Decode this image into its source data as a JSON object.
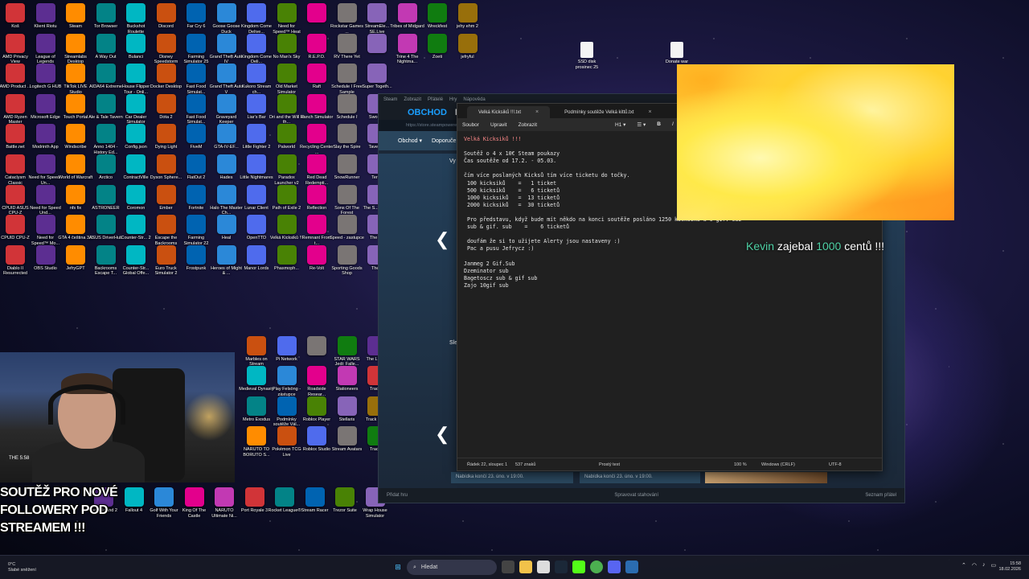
{
  "desktop": {
    "icons": [
      "Koš",
      "Klient Riotu",
      "Steam",
      "Tor Browser",
      "Buckshot Roulette",
      "Discord",
      "Far Cry 6",
      "Goose Goose Duck",
      "Kingdom Come Delive...",
      "Need for Speed™ Heat",
      "",
      "Rockstar Games ...",
      "StreamEle... SE.Live",
      "Tribes of Midgard",
      "Wreckfest",
      "jehy ehm 2",
      "AMD Privacy View",
      "League of Legends",
      "Streamlabs Desktop",
      "A Way Out",
      "Bulanci",
      "Disney Speedstorm",
      "Farming Simulator 25",
      "Grand Theft Auto IV",
      "Kingdom Come Deli...",
      "No Man's Sky",
      "R.E.P.O.",
      "RV There Yet",
      "",
      "Trine 4 The Nightma...",
      "Zoeti",
      "jefryful",
      "AMD Product ...",
      "Logitech G HUB",
      "TikTok LIVE Studio",
      "AIDA64 Extreme",
      "House Flipper Tour - Onli...",
      "Docker Desktop",
      "Fast Food Simulat...",
      "Grand Theft Auto V",
      "Kukoro Stream ch...",
      "Old Market Simulator",
      "Raft",
      "Schedule I Free Sample",
      "Super Togeth...",
      "",
      "",
      "",
      "AMD Ryzen Master",
      "Microsoft Edge",
      "Touch Portal",
      "Ale & Tale Tavern",
      "Car Dealer Simulator",
      "Dota 2",
      "Fast Food Simulat...",
      "Graveyard Keeper",
      "Liar's Bar",
      "Ori and the Will of th...",
      "Ranch Simulator",
      "Schedule I",
      "Sword...",
      "",
      "",
      "",
      "Battle.net",
      "Modrinth App",
      "Windscribe",
      "Anno 1404 - History Ed...",
      "Config.json",
      "Dying Light",
      "FiveM",
      "GTA-IV-EF...",
      "Little Fighter 2",
      "Palworld",
      "Recycling Center ...",
      "Slay the Spire",
      "Tavern...",
      "",
      "",
      "",
      "Cataclysm Classic",
      "Need for Speed - Un...",
      "World of Warcraft",
      "Arctico",
      "ContractVille",
      "Dyson Sphere...",
      "FlatOut 2",
      "Hades",
      "Little Nightmares",
      "Paradox Launcher v2",
      "Red Dead Redempti...",
      "SnowRunner",
      "Terr...",
      "",
      "",
      "",
      "CPUID ASUS CPU-Z",
      "Need for Speed Und...",
      "nfs fix",
      "ASTRONEER",
      "Coromon",
      "Ember",
      "Fortnite",
      "Halo The Master Ch...",
      "Lunar Client",
      "Path of Exile 2",
      "Reflection",
      "Sons Of The Forest",
      "The S... Sim...",
      "",
      "",
      "",
      "CPUID CPU-Z",
      "Need for Speed™ Mo...",
      "GTA 4 čeština 3.0",
      "ASUS DriverHub",
      "Counter-Str... 2",
      "Escape the Backrooms",
      "Farming Simulator 22",
      "Heal",
      "OpenTTD",
      "Velká Kicksiků !!!",
      "Remnant From t...",
      "Speed - zastupce",
      "The F...",
      "",
      "",
      "",
      "Diablo II Resurrected",
      "OBS Studio",
      "JefryGPT",
      "Backrooms Escape T...",
      "Counter-Str... Global Offe...",
      "Euro Truck Simulator 2",
      "Frostpunk",
      "Heroes of Might & ...",
      "Manor Lords",
      "Phasmoph...",
      "Re-Volt",
      "Sporting Goods Shop",
      "The...",
      "",
      "",
      ""
    ],
    "lower_icons": [
      "Marbles on Stream",
      "Pi Network",
      "",
      "STAR WARS Jedi: Falle...",
      "The L... Us",
      "Medieval Dynasty",
      "Play Felsöng - zástupce",
      "Roadside Resear...",
      "Stationeers",
      "Track...",
      "Metro Exodus",
      "Podmínky soutěže Vál...",
      "Roblox Player",
      "Stellaris",
      "Track Nat...",
      "NARUTO TO BORUTO S...",
      "Pokémon TCG Live",
      "Roblox Studio",
      "Stream Avatars",
      "Track...",
      "Dead Island 2",
      "Fallout 4",
      "Golf With Your Friends",
      "King Of The Castle",
      "NARUTO Ultimate Ni...",
      "Port Royale 3",
      "Rocket League®",
      "Stream Racer",
      "Trezor Suite",
      "Wrap House Simulator"
    ],
    "right_files": [
      {
        "label": "SSD disk prosinec 25"
      },
      {
        "label": "Donate war"
      }
    ]
  },
  "steam": {
    "topbar": [
      "Steam",
      "Zobrazit",
      "Přátelé",
      "Hry",
      "Nápověda"
    ],
    "nav_primary": "OBCHOD",
    "nav_secondary": "KN",
    "url": "https://store.steampowered.com/",
    "menu": [
      "Obchod ▾",
      "Doporuče..."
    ],
    "section_featured": "Vy",
    "section_sale": "Sle",
    "cards": [
      "Nabídka končí 23. úno. v 19:00.",
      "Nabídka končí 23. úno. v 19:00."
    ],
    "add_game": "Přidat hru",
    "downloads": "Spravovat stahování",
    "friends": "Seznam přátel"
  },
  "notepad": {
    "tabs": [
      {
        "label": "Velká Kicksiků !!!.txt"
      },
      {
        "label": "Podmínky soutěže Velká kittů.txt"
      }
    ],
    "menu": [
      "Soubor",
      "Upravit",
      "Zobrazit"
    ],
    "format": [
      "H1 ▾",
      "☰ ▾",
      "B",
      "I"
    ],
    "lines": [
      "Velká Kicksiků !!!",
      "",
      "Soutěž o 4 x 10€ Steam poukazy",
      "Čas soutěže od 17.2. - 05.03.",
      "",
      "čím více poslaných Kicksů tím více ticketu do točky.",
      " 100 kicksiků    =   1 ticket",
      " 500 kicksiků    =   6 ticketů",
      " 1000 kicksiků   =  13 ticketů",
      " 2000 kicksiků   =  30 ticketů",
      "",
      " Pro představu, když bude mít někdo na konci soutěže posláno 1250 kicksiků a 6 gif. sub =",
      " sub & gif. sub    =    6 ticketů",
      "",
      " doufám že si to užijete Alerty jsou nastaveny :)",
      " Pac a pusu Jefrycz :)",
      "",
      "Janmeg 2 Gif.Sub",
      "Dzeminator sub",
      "Bagetoscz sub & gif sub",
      "Zajo 10gif sub"
    ],
    "status": {
      "position": "Řádek 22, sloupec 1",
      "chars": "537 znaků",
      "format": "Prostý text",
      "zoom": "100 %",
      "eol": "Windows (CRLF)",
      "encoding": "UTF-8"
    }
  },
  "alert": {
    "name": "Kevin",
    "verb": "zajebal",
    "amount": "1000",
    "unit": "centů !!!"
  },
  "promo": [
    "SOUTĚŽ PRO NOVÉ",
    "FOLLOWERY POD",
    "STREAMEM !!!"
  ],
  "webcam_label": "THE 5:58",
  "taskbar": {
    "weather_temp": "0°C",
    "weather_desc": "Slabé sněžení",
    "search": "Hledat",
    "time": "15:58",
    "date": "18.02.2026"
  }
}
